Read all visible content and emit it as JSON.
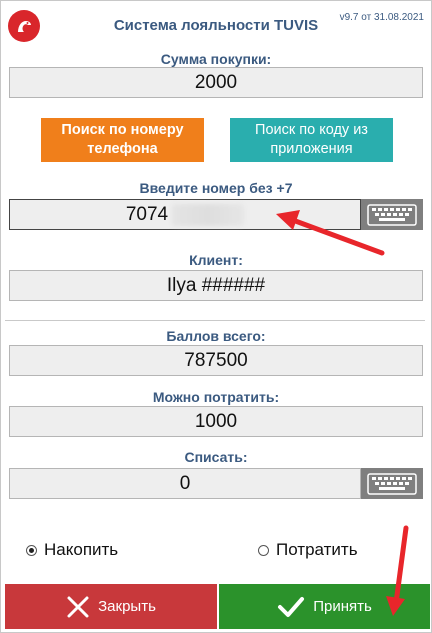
{
  "header": {
    "title": "Система лояльности TUVIS",
    "version": "v9.7 от 31.08.2021"
  },
  "purchase": {
    "label": "Сумма покупки:",
    "value": "2000"
  },
  "search": {
    "by_phone_label": "Поиск по номеру телефона",
    "by_app_code_label": "Поиск по коду из приложения"
  },
  "phone": {
    "label": "Введите номер без +7",
    "value": "7074"
  },
  "client": {
    "label": "Клиент:",
    "value": "Ilya ######"
  },
  "points": {
    "label": "Баллов всего:",
    "value": "787500"
  },
  "spendable": {
    "label": "Можно потратить:",
    "value": "1000"
  },
  "writeoff": {
    "label": "Списать:",
    "value": "0"
  },
  "mode": {
    "accumulate_label": "Накопить",
    "spend_label": "Потратить",
    "selected": "accumulate"
  },
  "actions": {
    "close_label": "Закрыть",
    "accept_label": "Принять"
  },
  "colors": {
    "accent": "#3b5a80",
    "orange": "#f07f1b",
    "teal": "#2aaeae",
    "close": "#c8383b",
    "accept": "#2b922b",
    "logo": "#d9262b",
    "annotation_arrow": "#e8262b"
  }
}
